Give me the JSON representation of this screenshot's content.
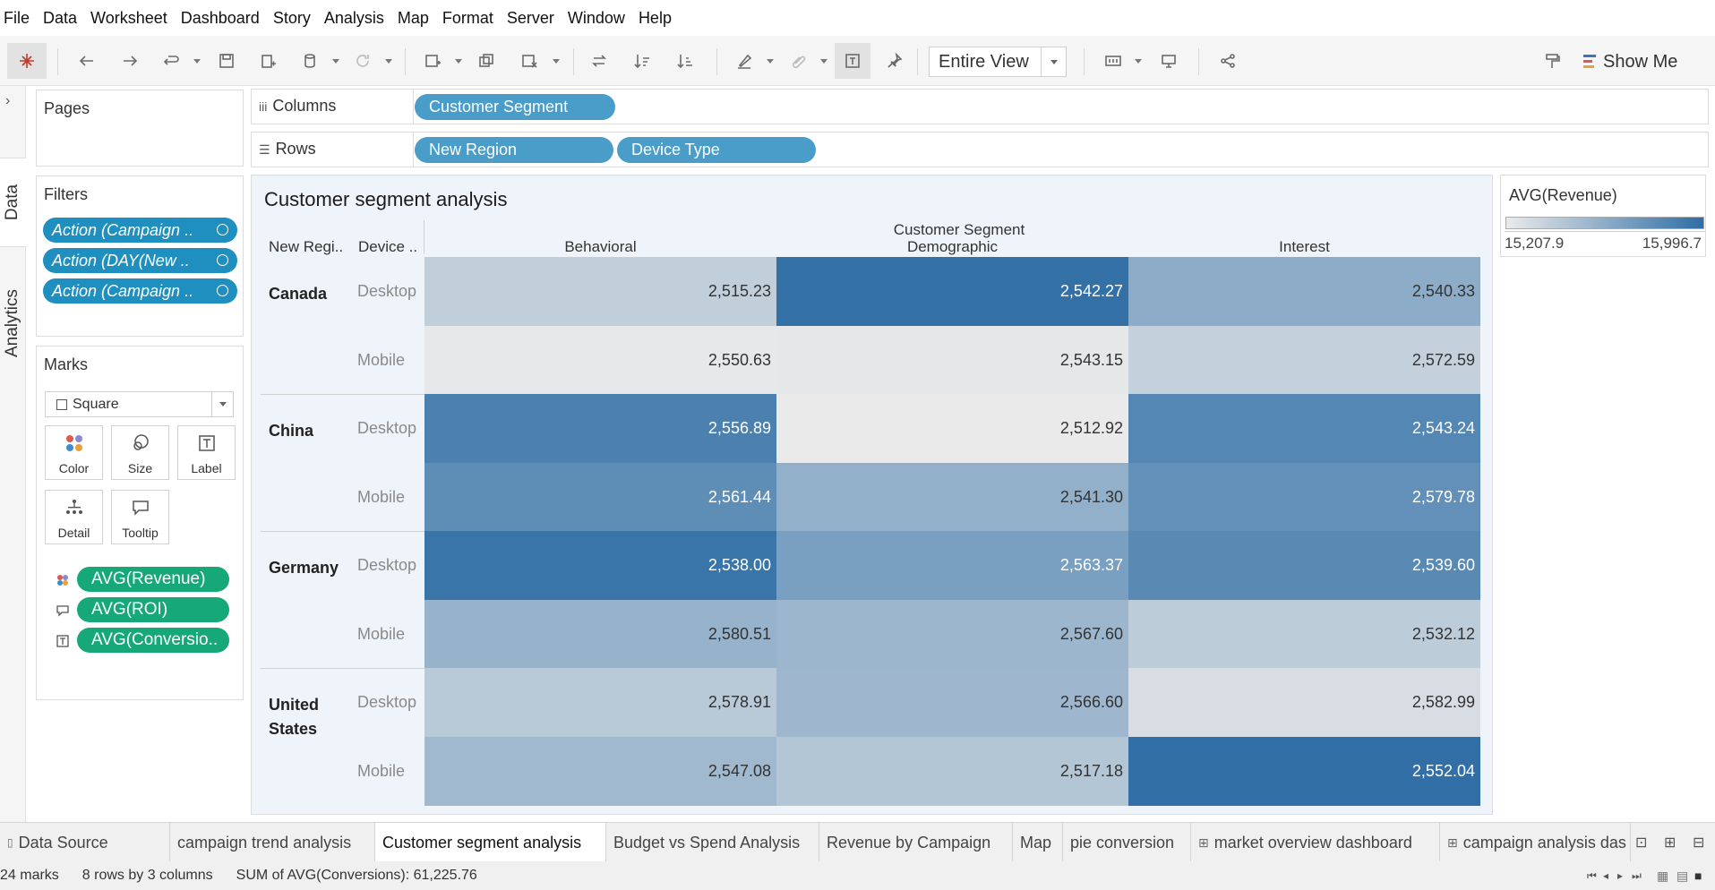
{
  "menu": [
    "File",
    "Data",
    "Worksheet",
    "Dashboard",
    "Story",
    "Analysis",
    "Map",
    "Format",
    "Server",
    "Window",
    "Help"
  ],
  "toolbar": {
    "fit_value": "Entire View",
    "show_me_label": "Show Me"
  },
  "side_tabs": {
    "data": "Data",
    "analytics": "Analytics"
  },
  "pages": {
    "title": "Pages"
  },
  "filters": {
    "title": "Filters",
    "items": [
      "Action (Campaign ..",
      "Action (DAY(New ..",
      "Action (Campaign .."
    ]
  },
  "marks": {
    "title": "Marks",
    "mark_type": "Square",
    "buttons": {
      "color": "Color",
      "size": "Size",
      "label": "Label",
      "detail": "Detail",
      "tooltip": "Tooltip"
    },
    "fields": [
      "AVG(Revenue)",
      "AVG(ROI)",
      "AVG(Conversio.."
    ]
  },
  "shelves": {
    "columns_label": "Columns",
    "columns": [
      "Customer Segment"
    ],
    "rows_label": "Rows",
    "rows": [
      "New Region",
      "Device Type"
    ]
  },
  "sheet": {
    "title": "Customer segment analysis",
    "row_header_1": "New Regi..",
    "row_header_2": "Device ..",
    "column_header_title": "Customer Segment"
  },
  "chart_data": {
    "type": "heatmap",
    "title": "Customer segment analysis",
    "columns_field": "Customer Segment",
    "rows_fields": [
      "New Region",
      "Device Type"
    ],
    "categories": [
      "Behavioral",
      "Demographic",
      "Interest"
    ],
    "rows": [
      {
        "region": "Canada",
        "device": "Desktop",
        "values": [
          "2,515.23",
          "2,542.27",
          "2,540.33"
        ],
        "color": [
          15380,
          15985,
          15600
        ]
      },
      {
        "region": "",
        "device": "Mobile",
        "values": [
          "2,550.63",
          "2,543.15",
          "2,572.59"
        ],
        "color": [
          15220,
          15230,
          15370
        ]
      },
      {
        "region": "China",
        "device": "Desktop",
        "values": [
          "2,556.89",
          "2,512.92",
          "2,543.24"
        ],
        "color": [
          15880,
          15210,
          15840
        ]
      },
      {
        "region": "",
        "device": "Mobile",
        "values": [
          "2,561.44",
          "2,541.30",
          "2,579.78"
        ],
        "color": [
          15800,
          15580,
          15780
        ]
      },
      {
        "region": "Germany",
        "device": "Desktop",
        "values": [
          "2,538.00",
          "2,563.37",
          "2,539.60"
        ],
        "color": [
          15950,
          15680,
          15820
        ]
      },
      {
        "region": "",
        "device": "Mobile",
        "values": [
          "2,580.51",
          "2,567.60",
          "2,532.12"
        ],
        "color": [
          15560,
          15540,
          15400
        ]
      },
      {
        "region": "United\nStates",
        "device": "Desktop",
        "values": [
          "2,578.91",
          "2,566.60",
          "2,582.99"
        ],
        "color": [
          15420,
          15530,
          15290
        ]
      },
      {
        "region": "",
        "device": "Mobile",
        "values": [
          "2,547.08",
          "2,517.18",
          "2,552.04"
        ],
        "color": [
          15520,
          15440,
          15990
        ]
      }
    ],
    "color_legend": {
      "title": "AVG(Revenue)",
      "min": "15,207.9",
      "max": "15,996.7",
      "range": [
        15207.9,
        15996.7
      ],
      "low_color": "#eaeaea",
      "high_color": "#2f6ea5"
    }
  },
  "tabs": {
    "data_source": "Data Source",
    "sheets": [
      "campaign trend analysis",
      "Customer segment analysis",
      "Budget vs Spend Analysis",
      "Revenue  by Campaign",
      "Map",
      "pie conversion",
      "market overview dashboard",
      "campaign analysis das"
    ],
    "active": "Customer segment analysis"
  },
  "status": {
    "marks": "24 marks",
    "dims": "8 rows by 3 columns",
    "sum": "SUM of AVG(Conversions): 61,225.76"
  }
}
